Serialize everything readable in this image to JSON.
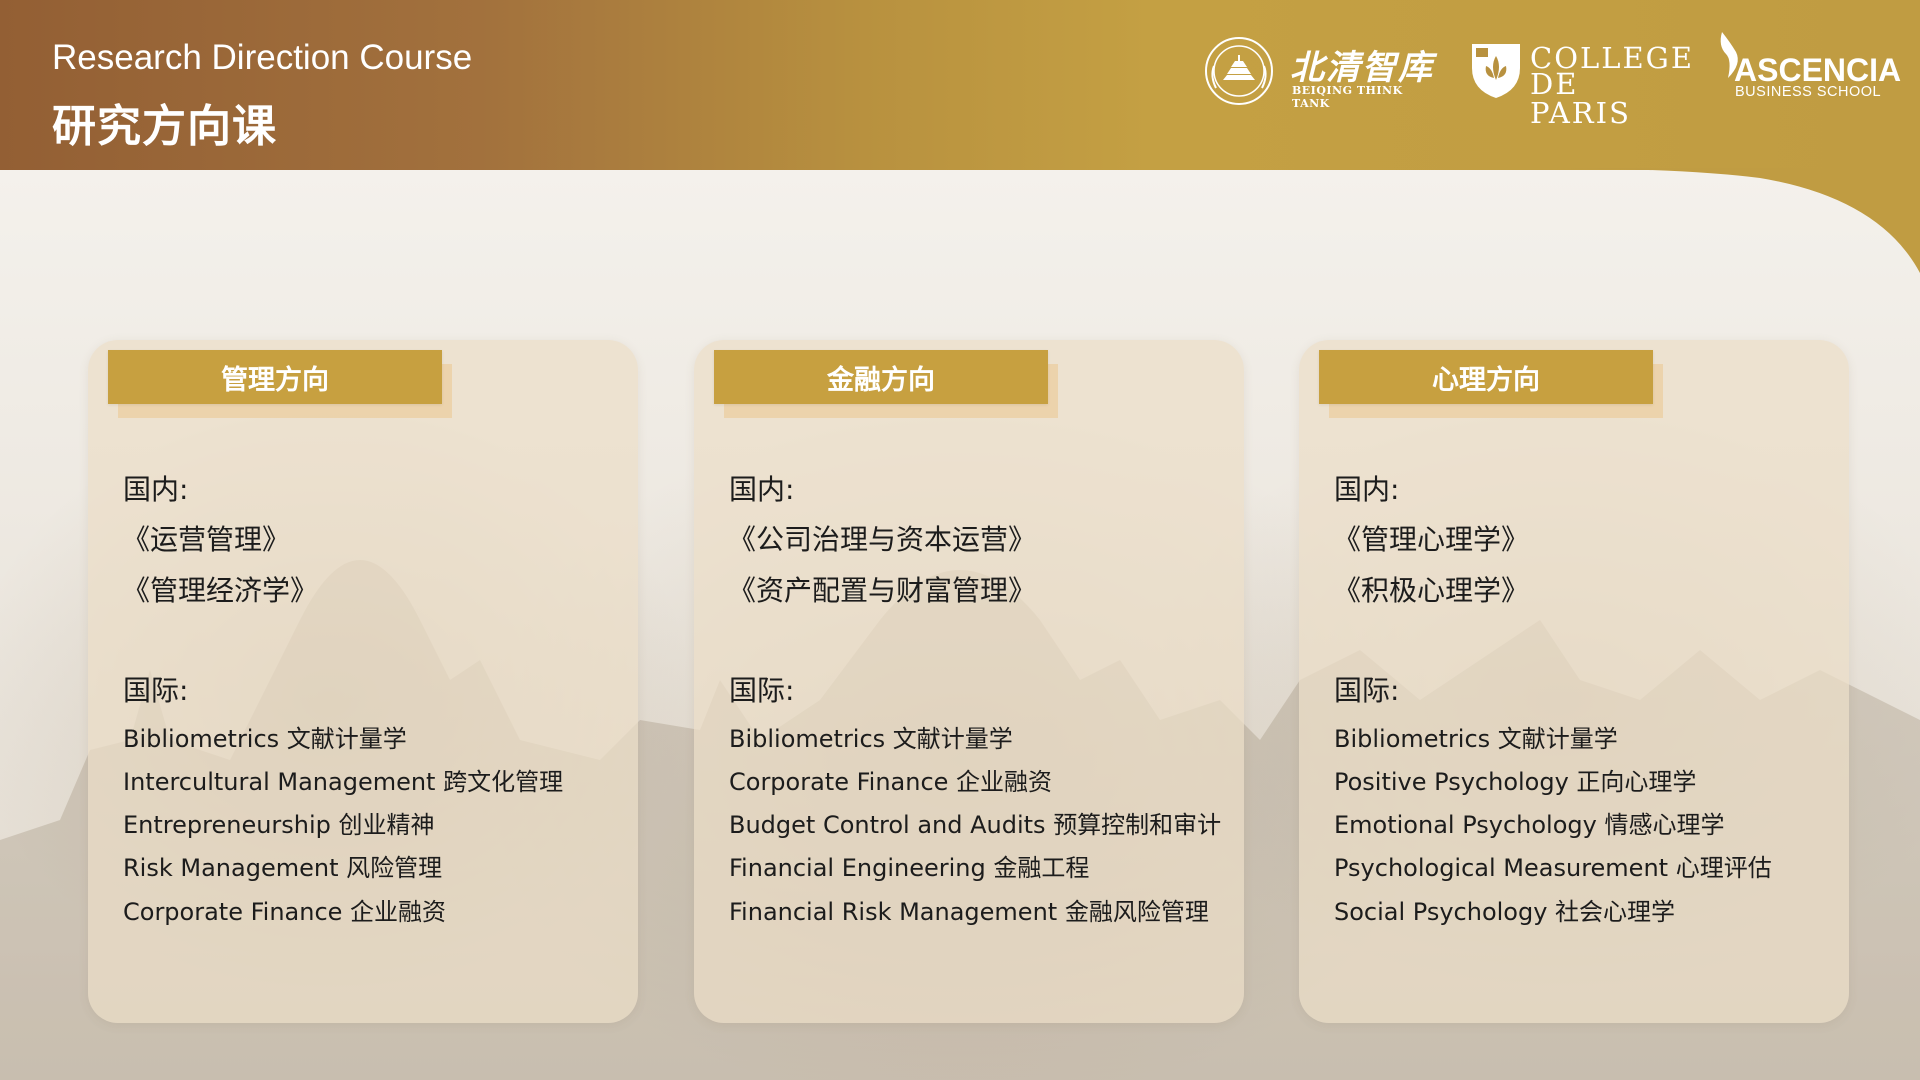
{
  "header": {
    "title_en": "Research Direction Course",
    "title_zh": "研究方向课",
    "logos": {
      "beiqing": {
        "name": "北清智库",
        "sub": "BEIQING THINK TANK",
        "icon": "temple-emblem-icon"
      },
      "college": {
        "line1": "COLLEGE",
        "line2": "DE PARIS",
        "icon": "fleur-de-lis-shield-icon"
      },
      "ascencia": {
        "name": "ASCENCIA",
        "sub": "BUSINESS SCHOOL",
        "icon": "flame-mark-icon"
      }
    }
  },
  "colors": {
    "header_start": "#935f34",
    "header_end": "#c09c42",
    "tag": "#c7a040",
    "card": "#ecdec7"
  },
  "cards": [
    {
      "title": "管理方向",
      "domestic_label": "国内:",
      "domestic": [
        "《运营管理》",
        "《管理经济学》"
      ],
      "intl_label": "国际:",
      "international": [
        "Bibliometrics 文献计量学",
        "Intercultural Management 跨文化管理",
        "Entrepreneurship 创业精神",
        "Risk Management 风险管理",
        "Corporate Finance 企业融资"
      ]
    },
    {
      "title": "金融方向",
      "domestic_label": "国内:",
      "domestic": [
        "《公司治理与资本运营》",
        "《资产配置与财富管理》"
      ],
      "intl_label": "国际:",
      "international": [
        "Bibliometrics 文献计量学",
        "Corporate Finance 企业融资",
        "Budget Control and Audits 预算控制和审计",
        "Financial Engineering 金融工程",
        "Financial Risk Management 金融风险管理"
      ]
    },
    {
      "title": "心理方向",
      "domestic_label": "国内:",
      "domestic": [
        "《管理心理学》",
        "《积极心理学》"
      ],
      "intl_label": "国际:",
      "international": [
        "Bibliometrics 文献计量学",
        "Positive Psychology 正向心理学",
        "Emotional Psychology 情感心理学",
        "Psychological Measurement 心理评估",
        "Social Psychology 社会心理学"
      ]
    }
  ]
}
